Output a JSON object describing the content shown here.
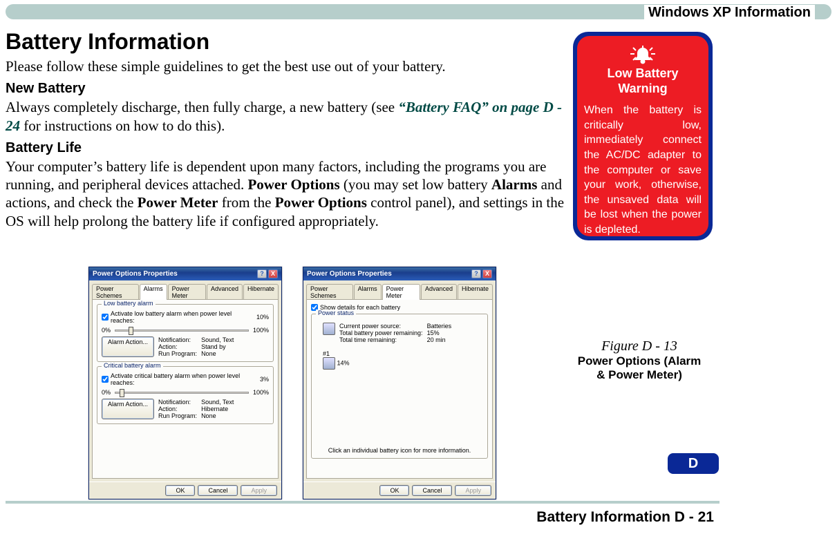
{
  "header": {
    "title": "Windows XP Information"
  },
  "section": {
    "h1": "Battery Information",
    "intro": "Please follow these simple guidelines to get the best use out of your battery.",
    "newBattery": {
      "heading": "New Battery",
      "p1a": "Always completely discharge, then fully charge, a new battery (see ",
      "ref": "“Battery FAQ” on page D - 24",
      "p1b": " for instructions on how to do this)."
    },
    "batteryLife": {
      "heading": "Battery Life",
      "p1a": "Your computer’s battery life is dependent upon many factors, including the programs you are running, and peripheral devices attached. ",
      "b1": "Power Options",
      "p1b": " (you may set low battery ",
      "b2": "Alarms",
      "p1c": " and actions, and check the ",
      "b3": "Power Meter",
      "p1d": " from the ",
      "b4": "Power Options",
      "p1e": " control panel), and settings in the OS will help prolong the battery life if configured appropriately."
    }
  },
  "callout": {
    "title": "Low Battery Warning",
    "body": "When the battery is critically low, immediately connect the AC/DC adapter to the computer or save your work, otherwise, the unsaved data will be lost when the power is depleted."
  },
  "dialog": {
    "title": "Power Options Properties",
    "help": "?",
    "close": "X",
    "tabs": {
      "schemes": "Power Schemes",
      "alarms": "Alarms",
      "meter": "Power Meter",
      "advanced": "Advanced",
      "hibernate": "Hibernate"
    },
    "alarms": {
      "lowGroup": "Low battery alarm",
      "lowChk": "Activate low battery alarm when power level reaches:",
      "lowPct": "10%",
      "pct0": "0%",
      "pct100": "100%",
      "alarmAction": "Alarm Action...",
      "notifLabel": "Notification:",
      "notifVal": "Sound, Text",
      "actionLabel": "Action:",
      "actionValStandby": "Stand by",
      "runLabel": "Run Program:",
      "runVal": "None",
      "critGroup": "Critical battery alarm",
      "critChk": "Activate critical battery alarm when power level reaches:",
      "critPct": "3%",
      "actionValHib": "Hibernate"
    },
    "meter": {
      "showChk": "Show details for each battery",
      "statusGroup": "Power status",
      "curSrcLabel": "Current power source:",
      "curSrcVal": "Batteries",
      "totLabel": "Total battery power remaining:",
      "totVal": "15%",
      "timeLabel": "Total time remaining:",
      "timeVal": "20 min",
      "battNum": "#1",
      "battPct": "14%",
      "hint": "Click an individual battery icon for more information."
    },
    "ok": "OK",
    "cancel": "Cancel",
    "apply": "Apply"
  },
  "figure": {
    "num": "Figure D - 13",
    "title": "Power Options (Alarm & Power Meter)"
  },
  "sectionTab": "D",
  "footer": "Battery Information  D - 21"
}
